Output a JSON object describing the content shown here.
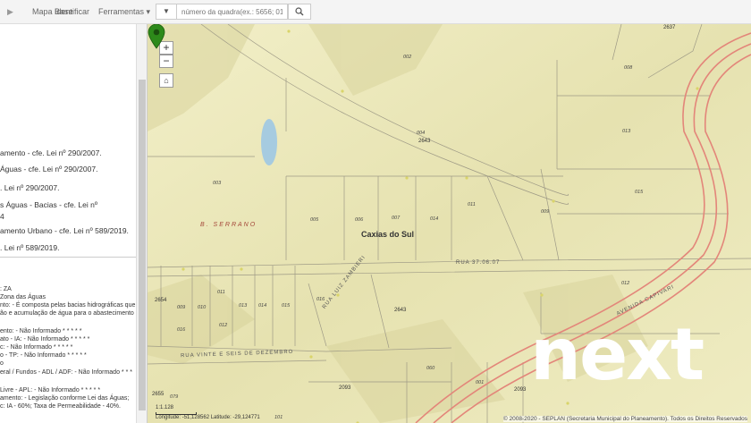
{
  "nav": {
    "mapa_base": "Mapa Base",
    "identificar": "Identificar",
    "ferramentas": "Ferramentas"
  },
  "search": {
    "placeholder": "número da quadra(ex.: 5656; 01"
  },
  "sidebar": {
    "layers": [
      "amento - cfe. Lei nº 290/2007.",
      "Águas - cfe. Lei nº 290/2007.",
      ". Lei nº 290/2007.",
      "s Águas - Bacias - cfe. Lei nº",
      "4",
      "amento Urbano - cfe. Lei nº 589/2019.",
      ". Lei nº 589/2019."
    ],
    "info": [
      ": ZA",
      "Zona das Águas",
      "nto: - É composta pelas bacias hidrográficas que",
      "ão e acumulação de água para o abastecimento",
      "",
      "ento: - Não Informado * * * * *",
      "ato - IA: - Não Informado * * * * *",
      "c: - Não Informado * * * * *",
      "o - TP: - Não Informado * * * * *",
      "o",
      "eral / Fundos - ADL / ADF: - Não Informado * * *",
      "",
      "Livre - APL: - Não Informado * * * * *",
      "amento: - Legislação conforme Lei das Águas;",
      "c: IA - 60%; Taxa de Permeabilidade - 40%."
    ]
  },
  "map": {
    "zoom_in": "+",
    "zoom_out": "−",
    "home_icon": "home-icon",
    "city": "Caxias do Sul",
    "bairro": "B. SERRANO",
    "streets": {
      "rua_37": "RUA 37.06.07",
      "luiz_zambieri": "RUA LUIZ ZAMBIERI",
      "vinte_seis": "RUA VINTE E SEIS DE DEZEMBRO",
      "capivari": "AVENIDA CAPIVARI"
    },
    "blocks": {
      "b2637": "2637",
      "b2643a": "2643",
      "b2643b": "2643",
      "b2654": "2654",
      "b2655": "2655",
      "b2093a": "2093",
      "b2093b": "2093"
    },
    "parcels": {
      "p002": "002",
      "p004": "004",
      "p003": "003",
      "p005": "005",
      "p006": "006",
      "p007": "007",
      "p014": "014",
      "p011a": "011",
      "p008": "008",
      "p013": "013",
      "p009": "009",
      "p015": "015",
      "p016": "016",
      "p012": "012",
      "m009": "009",
      "m010": "010",
      "m011": "011",
      "m012": "012",
      "m013": "013",
      "m014": "014",
      "m015": "015",
      "m016": "016",
      "p060": "060",
      "p001": "001",
      "p079": "079",
      "p101": "101"
    },
    "scale": "1:1.128",
    "coords": "Longitude: -51,128562  Latitude: -29,124771",
    "attribution": "© 2008-2020 - SEPLAN (Secretaria Municipal do Planeamento). Todos os Direitos Reservados",
    "watermark": "next"
  },
  "colors": {
    "map_bg": "#ece8b9",
    "marker": "#2d8a1a",
    "road": "#e3867a"
  }
}
